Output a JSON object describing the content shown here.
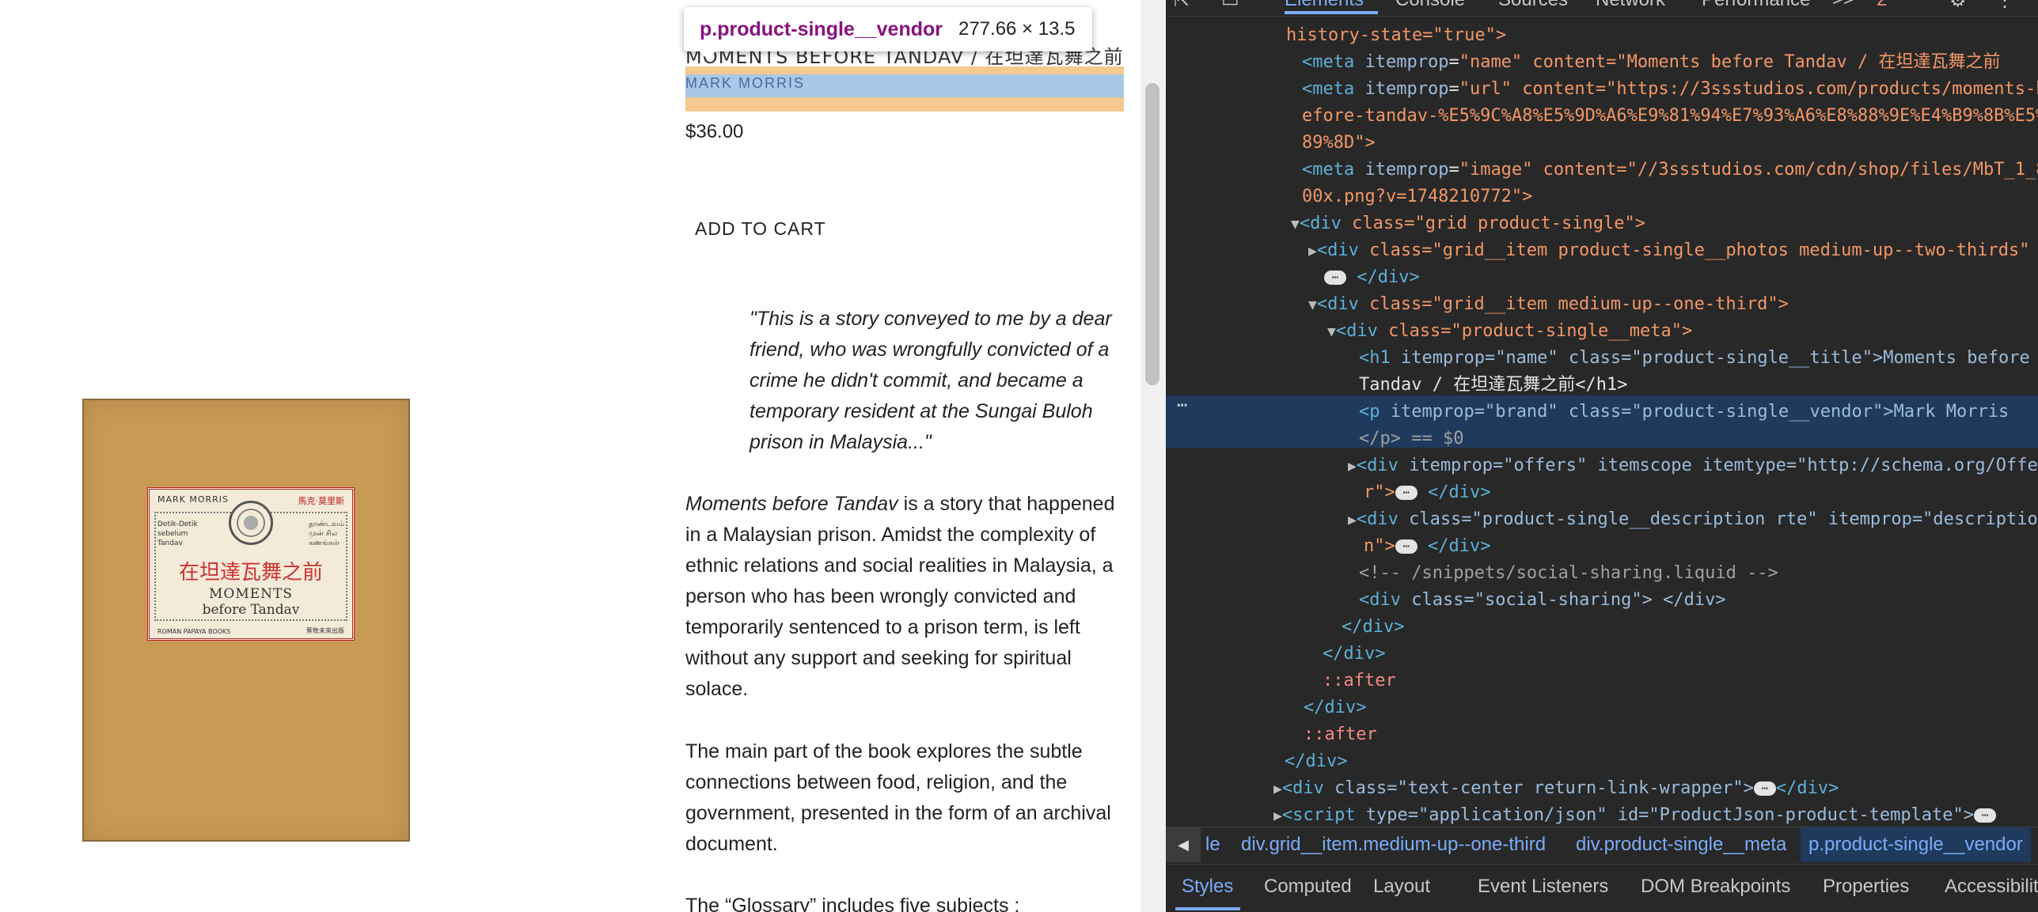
{
  "tooltip": {
    "selector": "p.product-single__vendor",
    "dimensions": "277.66 × 13.5"
  },
  "product": {
    "title": "MOMENTS BEFORE TANDAV / 在坦達瓦舞之前",
    "vendor": "MARK MORRIS",
    "price": "$36.00",
    "add_to_cart": "ADD TO CART",
    "quote": "\"This is a story conveyed to me by a dear friend, who was wrongfully convicted of a crime he didn't commit, and became a temporary resident at the Sungai Buloh prison in Malaysia...\"",
    "desc1_italic": "Moments before Tandav",
    "desc1_rest": " is a story that happened in a Malaysian prison. Amidst the complexity of ethnic relations and social realities in Malaysia, a person who has been wrongly convicted and temporarily sentenced to a prison term, is left without any support and seeking for spiritual solace.",
    "desc2": "The main part of the book explores the subtle connections between food, religion, and the government, presented in the form of an archival document.",
    "desc3": "The “Glossary” includes five subjects :"
  },
  "book_cover": {
    "author": "MARK MORRIS",
    "cjk_author": "馬克·莫里斯",
    "left_text": "Detik-Detik\nsebelum\nTandav",
    "right_text": "தாண்டவம்\nமுன் சில\nகணங்கள்",
    "cjk_title": "在坦達瓦舞之前",
    "title_line1": "MOMENTS",
    "title_line2": "before Tandav",
    "footer_left": "ROMAN PAPAYA BOOKS",
    "footer_right": "蕉牧未來出版"
  },
  "devtools": {
    "tabs": [
      "Elements",
      "Console",
      "Sources",
      "Network",
      "Performance",
      ">>"
    ],
    "active_tab": "Elements",
    "error_count": "2",
    "breadcrumbs": [
      "le",
      "div.grid__item.medium-up--one-third",
      "div.product-single__meta",
      "p.product-single__vendor"
    ],
    "subtabs": [
      "Styles",
      "Computed",
      "Layout",
      "Event Listeners",
      "DOM Breakpoints",
      "Properties",
      "Accessibility"
    ],
    "active_subtab": "Styles",
    "lines": {
      "l0": "history-state=\"true\">",
      "l1_name": "content=\"Moments before Tandav / 在坦達瓦舞之前",
      "l2_a": "content=\"https://3ssstudios.com/products/moments-b",
      "l2_b": "efore-tandav-%E5%9C%A8%E5%9D%A6%E9%81%94%E7%93%A6%E8%88%9E%E4%B9%8B%E5%",
      "l2_c": "89%8D\">",
      "l3_a": "content=\"//3ssstudios.com/cdn/shop/files/MbT_1_8",
      "l3_b": "00x.png?v=1748210772\">",
      "l4": "class=\"grid product-single\">",
      "l5": "class=\"grid__item product-single__photos medium-up--two-thirds\"",
      "l6": "class=\"grid__item medium-up--one-third\">",
      "l7": "class=\"product-single__meta\">",
      "l8_a": "itemprop=\"name\" class=\"product-single__title\">Moments before",
      "l8_b": "Tandav / 在坦達瓦舞之前</h1>",
      "l9_a": "itemprop=\"brand\" class=\"product-single__vendor\">Mark Morris",
      "l9_b": "</p> == $0",
      "l10": "itemprop=\"offers\" itemscope itemtype=\"http://schema.org/Offe",
      "l10_b": "r\">",
      "l11": "class=\"product-single__description rte\" itemprop=\"descriptio",
      "l11_b": "n\">",
      "l12": "<!-- /snippets/social-sharing.liquid -->",
      "l13": "class=\"social-sharing\"> </div>",
      "l14": "</div>",
      "l15": "</div>",
      "l16": "::after",
      "l17": "</div>",
      "l18": "::after",
      "l19": "</div>",
      "l20": "class=\"text-center return-link-wrapper\">",
      "l21": "type=\"application/json\" id=\"ProductJson-product-template\">"
    }
  }
}
